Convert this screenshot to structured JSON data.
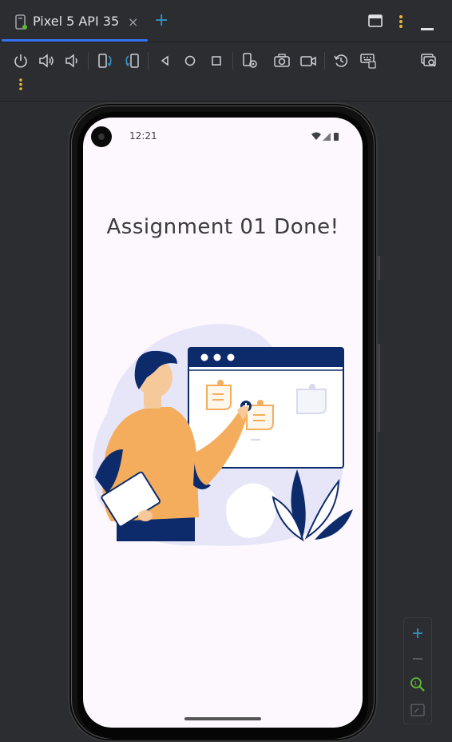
{
  "tab": {
    "title": "Pixel 5 API 35",
    "close_glyph": "×",
    "add_glyph": "+",
    "device_icon": "device-icon"
  },
  "window_controls": {
    "layout_icon": "window-layout-icon",
    "more_icon": "more-vertical-icon",
    "minimize_icon": "minimize-icon"
  },
  "toolbar": {
    "items": [
      "power-icon",
      "volume-up-icon",
      "volume-down-icon",
      "rotate-left-icon",
      "rotate-right-icon",
      "back-icon",
      "home-icon",
      "overview-icon",
      "extended-controls-icon",
      "screenshot-icon",
      "screen-record-icon",
      "snapshot-icon",
      "keyboard-icon",
      "device-mirror-icon",
      "more-vertical-icon"
    ]
  },
  "device": {
    "clock": "12:21",
    "headline": "Assignment 01 Done!"
  },
  "zoom": {
    "zoom_in_glyph": "+",
    "zoom_out_glyph": "−",
    "items": [
      "zoom-in-icon",
      "zoom-out-icon",
      "zoom-actual-icon",
      "zoom-fit-icon"
    ]
  },
  "colors": {
    "accent": "#3574f0",
    "screen_bg": "#fdf7fe",
    "navy": "#0d2a6b",
    "orange": "#f3ad5c",
    "lavender": "#e6e6f8"
  }
}
